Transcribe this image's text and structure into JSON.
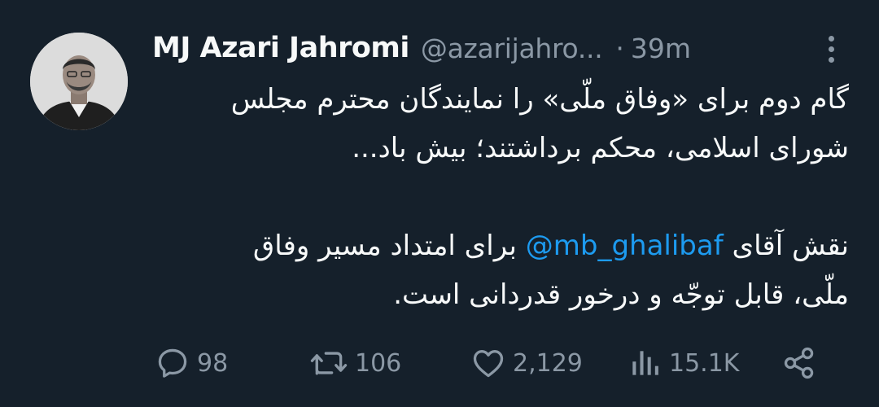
{
  "tweet": {
    "display_name": "MJ Azari Jahromi",
    "handle": "@azarijahro...",
    "separator": "·",
    "time": "39m",
    "body": {
      "line1": "گام دوم برای «وفاق ملّی» را نمایندگان محترم مجلس",
      "line2": "شورای اسلامی، محکم برداشتند؛ بیش باد...",
      "line3_before": "نقش آقای ",
      "mention": "@mb_ghalibaf",
      "line3_after": " برای امتداد مسیر وفاق",
      "line4": "ملّی، قابل توجّه و درخور قدردانی است."
    },
    "actions": {
      "replies": "98",
      "retweets": "106",
      "likes": "2,129",
      "views": "15.1K"
    },
    "icons": {
      "reply": "reply-icon",
      "retweet": "retweet-icon",
      "like": "heart-icon",
      "views": "views-icon",
      "share": "share-icon",
      "more": "more-icon"
    },
    "colors": {
      "background": "#15202b",
      "text": "#f7f9f9",
      "muted": "#8b98a5",
      "link": "#1d9bf0"
    }
  }
}
